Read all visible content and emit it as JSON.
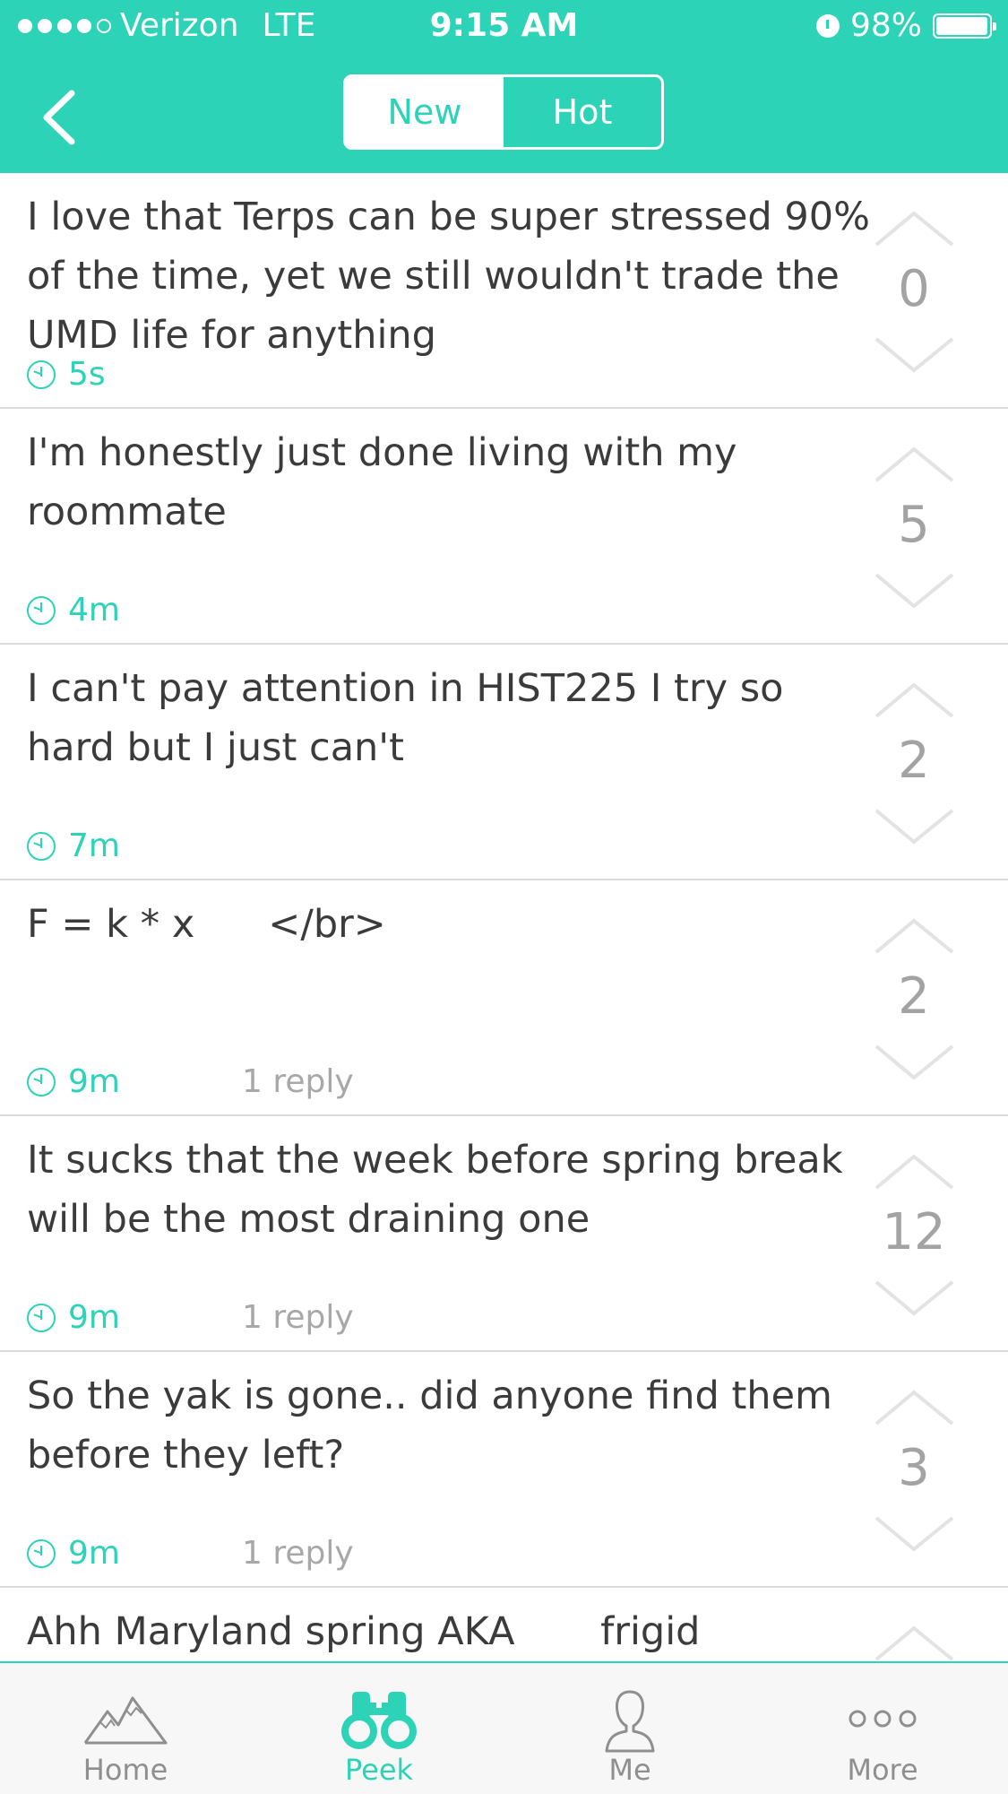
{
  "status_bar": {
    "carrier": "Verizon",
    "network": "LTE",
    "time": "9:15 AM",
    "battery": "98%",
    "battery_level": 0.98,
    "signal_bars": 4,
    "signal_total": 5
  },
  "header": {
    "back_icon": "chevron-left-icon",
    "tabs": [
      {
        "label": "New",
        "selected": true
      },
      {
        "label": "Hot",
        "selected": false
      }
    ]
  },
  "colors": {
    "accent": "#2dd3b6",
    "text": "#3b3b3b",
    "muted": "#a3a3a3",
    "divider": "#dcdcdc"
  },
  "posts": [
    {
      "text": "I love that Terps can be super stressed 90% of the time, yet we still wouldn't trade the UMD life for anything",
      "time": "5s",
      "replies": "",
      "score": "0"
    },
    {
      "text": "I'm honestly just done living with my roommate",
      "time": "4m",
      "replies": "",
      "score": "5"
    },
    {
      "text": "I can't pay attention in HIST225 I try so hard but I just can't",
      "time": "7m",
      "replies": "",
      "score": "2"
    },
    {
      "text": "F = k * x      </br>",
      "time": "9m",
      "replies": "1 reply",
      "score": "2"
    },
    {
      "text": "It sucks that the week before spring break will be the most draining one",
      "time": "9m",
      "replies": "1 reply",
      "score": "12"
    },
    {
      "text": "So the yak is gone.. did anyone find them before they left?",
      "time": "9m",
      "replies": "1 reply",
      "score": "3"
    },
    {
      "text": "Ahh Maryland spring AKA       frigid",
      "time": "",
      "replies": "",
      "score": ""
    }
  ],
  "tabbar": {
    "items": [
      {
        "label": "Home",
        "icon": "mountain-icon",
        "active": false
      },
      {
        "label": "Peek",
        "icon": "binoculars-icon",
        "active": true
      },
      {
        "label": "Me",
        "icon": "person-icon",
        "active": false
      },
      {
        "label": "More",
        "icon": "more-dots-icon",
        "active": false
      }
    ]
  }
}
